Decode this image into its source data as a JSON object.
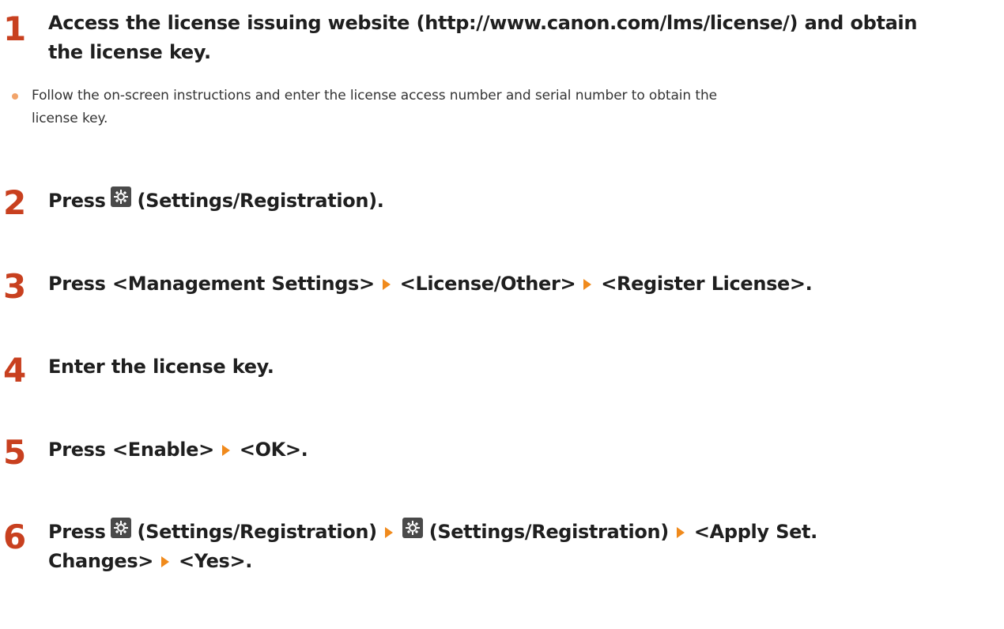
{
  "steps": [
    {
      "number": "1",
      "lines": [
        "Access the license issuing website (http://www.canon.com/lms/license/) and obtain",
        "the license key."
      ]
    },
    {
      "number": "2",
      "press": "Press",
      "settings": "(Settings/Registration)."
    },
    {
      "number": "3",
      "press": "Press",
      "items": [
        "<Management Settings>",
        "<License/Other>",
        "<Register License>."
      ]
    },
    {
      "number": "4",
      "text": "Enter the license key."
    },
    {
      "number": "5",
      "press": "Press",
      "items": [
        "<Enable>",
        "<OK>."
      ]
    },
    {
      "number": "6",
      "press": "Press",
      "settings_a": "(Settings/Registration)",
      "settings_b": "(Settings/Registration)",
      "item_a": "<Apply Set.",
      "item_b": "Changes>",
      "item_c": "<Yes>."
    }
  ],
  "bullet": {
    "lines": [
      "Follow the on-screen instructions and enter the license access number and serial number to obtain the",
      "license key."
    ]
  },
  "colors": {
    "step_number": "#c8401f",
    "arrow": "#f08a1c",
    "bullet": "#f2a46a",
    "icon_bg": "#4a4a4a"
  },
  "icons": {
    "settings": "gear-icon",
    "arrow": "triangle-right-icon"
  }
}
